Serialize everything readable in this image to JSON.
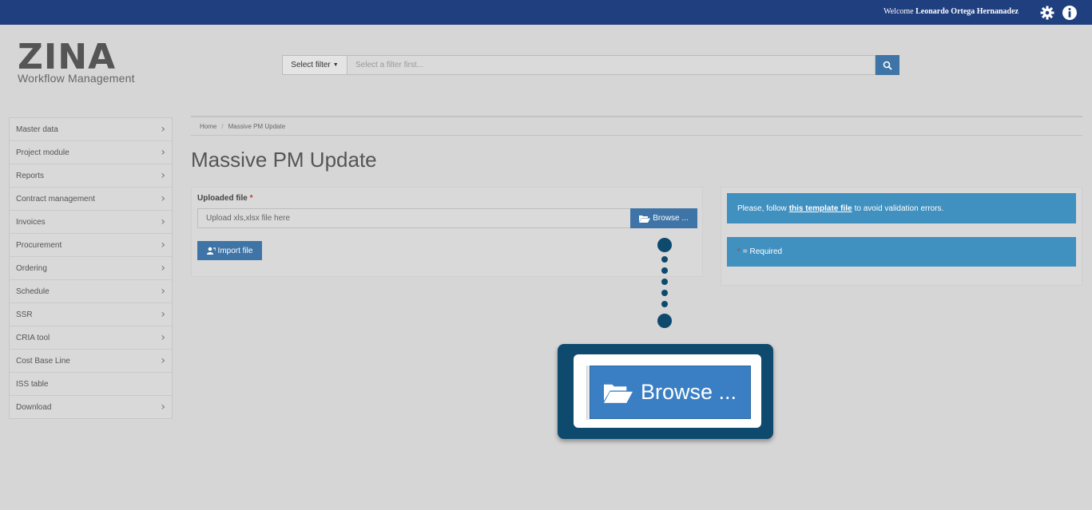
{
  "topbar": {
    "welcome_prefix": "Welcome",
    "user_name": "Leonardo Ortega Hernanadez",
    "icons": [
      "gear-icon",
      "info-icon"
    ]
  },
  "logo": {
    "main": "ZINA",
    "sub": "Workflow Management"
  },
  "search": {
    "filter_label": "Select filter",
    "placeholder": "Select a filter first...",
    "icon": "search-icon"
  },
  "sidebar": {
    "items": [
      {
        "label": "Master data",
        "has_submenu": true
      },
      {
        "label": "Project module",
        "has_submenu": true
      },
      {
        "label": "Reports",
        "has_submenu": true
      },
      {
        "label": "Contract management",
        "has_submenu": true
      },
      {
        "label": "Invoices",
        "has_submenu": true
      },
      {
        "label": "Procurement",
        "has_submenu": true
      },
      {
        "label": "Ordering",
        "has_submenu": true
      },
      {
        "label": "Schedule",
        "has_submenu": true
      },
      {
        "label": "SSR",
        "has_submenu": true
      },
      {
        "label": "CRIA tool",
        "has_submenu": true
      },
      {
        "label": "Cost Base Line",
        "has_submenu": true
      },
      {
        "label": "ISS table",
        "has_submenu": false
      },
      {
        "label": "Download",
        "has_submenu": true
      }
    ]
  },
  "breadcrumb": {
    "home": "Home",
    "current": "Massive PM Update"
  },
  "page": {
    "title": "Massive PM Update"
  },
  "upload": {
    "label": "Uploaded file",
    "required_mark": "*",
    "placeholder": "Upload xls,xlsx file here",
    "browse_label": "Browse ...",
    "import_label": "Import file"
  },
  "info": {
    "template_prefix": "Please, follow",
    "template_link": "this template file",
    "template_suffix": "to avoid validation errors.",
    "required_mark": "*",
    "required_text": "= Required"
  },
  "callout": {
    "browse_label": "Browse ..."
  },
  "colors": {
    "topbar": "#1f3f7f",
    "button": "#3f74a7",
    "info": "#4090c0",
    "callout": "#0e4a6e"
  }
}
